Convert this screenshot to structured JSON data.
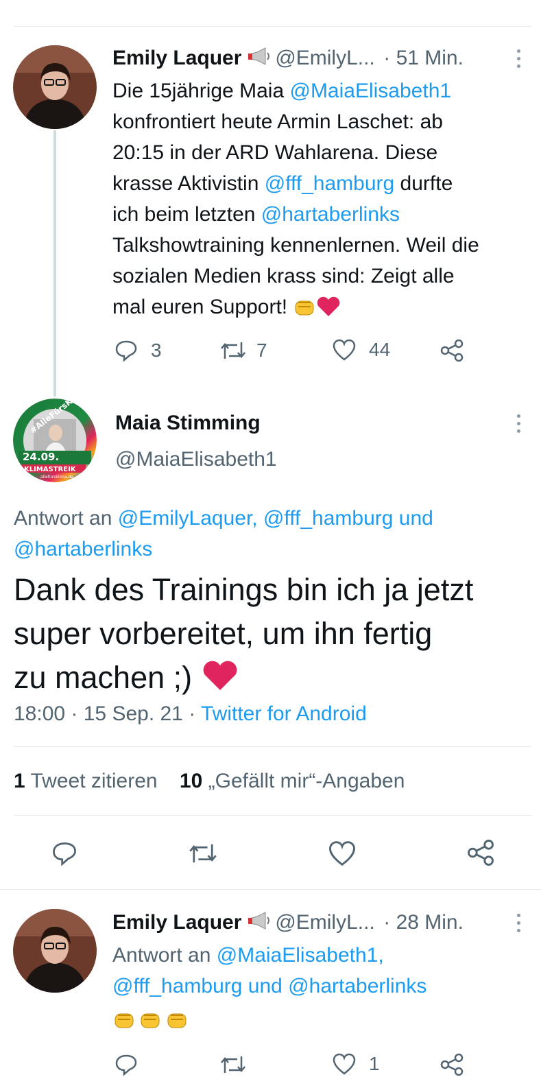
{
  "tweet1": {
    "name": "Emily Laquer",
    "handle": "@EmilyL...",
    "time": "· 51 Min.",
    "text": {
      "p1": "Die 15jährige Maia ",
      "m1": "@MaiaElisabeth1",
      "p2": "konfrontiert heute Armin Laschet: ab",
      "p3": "20:15 in der ARD Wahlarena. Diese",
      "p4": "krasse Aktivistin ",
      "m2": "@fff_hamburg",
      "p4b": " durfte",
      "p5": "ich beim letzten ",
      "m3": "@hartaberlinks",
      "p6": "Talkshowtraining kennenlernen. Weil die",
      "p7": "sozialen Medien krass sind: Zeigt alle",
      "p8": "mal euren Support! "
    },
    "replies": "3",
    "retweets": "7",
    "likes": "44"
  },
  "main_tweet": {
    "name": "Maia Stimming",
    "handle": "@MaiaElisabeth1",
    "avatar_text": {
      "hashtag": "#AlleFürsKlima",
      "date": "24.09.",
      "strike": "KLIMASTREIK",
      "url": "allefürsklima.de"
    },
    "reply_to_prefix": "Antwort an ",
    "reply_to_1": "@EmilyLaquer, @fff_hamburg und",
    "reply_to_2": "@hartaberlinks",
    "text_1": "Dank des Trainings bin ich ja jetzt",
    "text_2": "super vorbereitet, um ihn fertig",
    "text_3": "zu machen ;) ",
    "timestamp": "18:00 · 15 Sep. 21 · ",
    "source": "Twitter for Android",
    "quote_count": "1",
    "quote_label": "Tweet zitieren",
    "like_count": "10",
    "like_label": "„Gefällt mir“-Angaben"
  },
  "tweet3": {
    "name": "Emily Laquer",
    "handle": "@EmilyL...",
    "time": "· 28 Min.",
    "reply_prefix": "Antwort an ",
    "reply_1": "@MaiaElisabeth1,",
    "reply_2": "@fff_hamburg und @hartaberlinks",
    "likes": "1"
  },
  "colors": {
    "link": "#1d9bf0",
    "muted": "#536471",
    "heart": "#e0245e"
  }
}
